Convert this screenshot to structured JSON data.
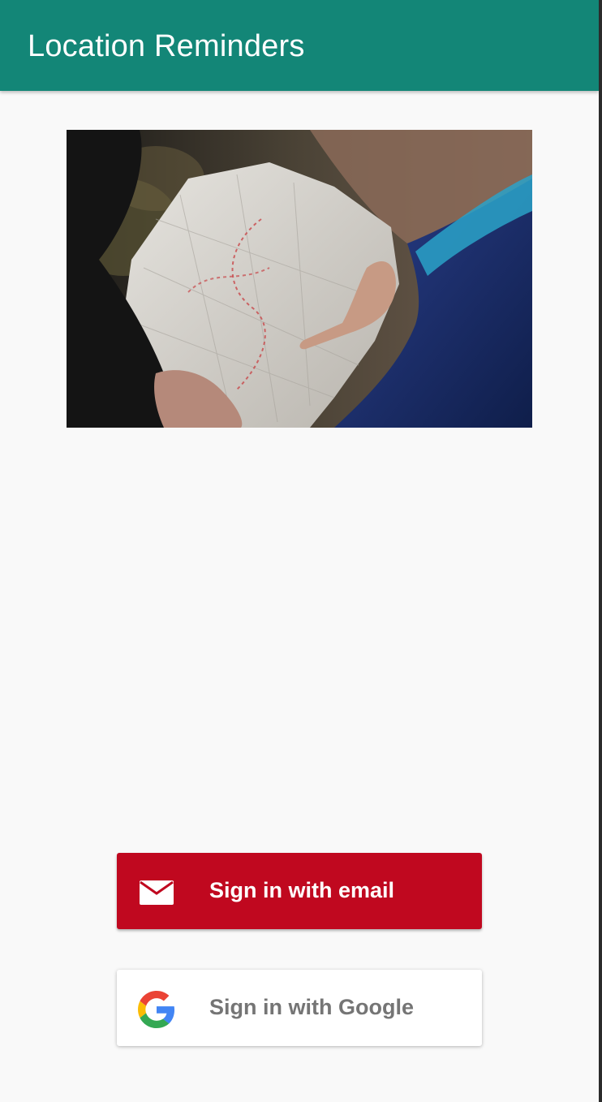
{
  "app_bar": {
    "title": "Location Reminders",
    "color": "#138677"
  },
  "hero_image": {
    "subject": "people-reading-paper-map"
  },
  "auth": {
    "email_button": {
      "label": "Sign in with email",
      "icon": "envelope-icon",
      "color": "#c0081f"
    },
    "google_button": {
      "label": "Sign in with Google",
      "icon": "google-logo-icon",
      "color": "#ffffff"
    }
  }
}
